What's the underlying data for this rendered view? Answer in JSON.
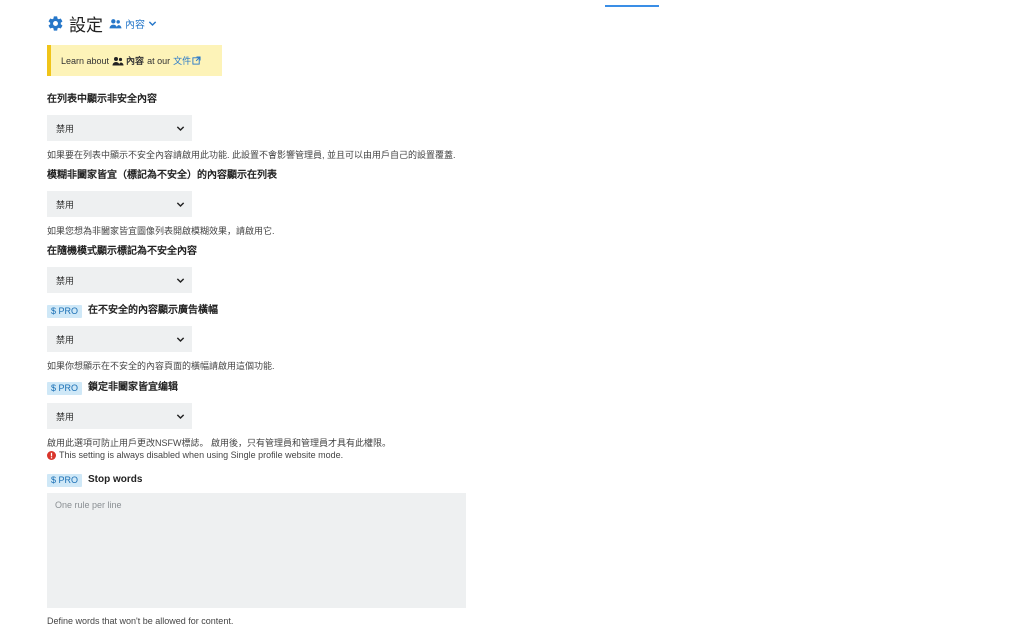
{
  "header": {
    "title": "設定",
    "dropdown_label": "內容"
  },
  "notice": {
    "prefix": "Learn about",
    "subject": "內容",
    "middle": "at our",
    "link": "文件"
  },
  "settings": [
    {
      "label": "在列表中顯示非安全內容",
      "pro": false,
      "value": "禁用",
      "help": "如果要在列表中顯示不安全內容請啟用此功能. 此設置不會影響管理員, 並且可以由用戶自己的設置覆蓋."
    },
    {
      "label": "模糊非闔家皆宜（標記為不安全）的內容顯示在列表",
      "pro": false,
      "value": "禁用",
      "help": "如果您想為非闔家皆宜圖像列表開啟模糊效果，請啟用它."
    },
    {
      "label": "在隨機模式顯示標記為不安全內容",
      "pro": false,
      "value": "禁用",
      "help": ""
    },
    {
      "label": "在不安全的內容顯示廣告橫幅",
      "pro": true,
      "pro_label": "$ PRO",
      "value": "禁用",
      "help": "如果你想顯示在不安全的內容頁面的橫幅請啟用這個功能."
    },
    {
      "label": "鎖定非闔家皆宜编辑",
      "pro": true,
      "pro_label": "$ PRO",
      "value": "禁用",
      "help": "啟用此選項可防止用戶更改NSFW標誌。 啟用後，只有管理員和管理員才具有此權限。",
      "warning": "This setting is always disabled when using Single profile website mode."
    }
  ],
  "stop_words": {
    "pro_label": "$ PRO",
    "label": "Stop words",
    "placeholder": "One rule per line",
    "help": "Define words that won't be allowed for content."
  },
  "colors": {
    "accent": "#2677c9",
    "notice_bg": "#fdf3b8",
    "notice_border": "#f0c419",
    "pro_badge_bg": "#cfe8f7",
    "field_bg": "#eef0f1",
    "warning_red": "#d9352b"
  },
  "icons": {
    "title_icon": "gear-icon",
    "dropdown_icon": "people-icon",
    "link_icon": "external-link-icon",
    "warning_icon": "exclamation-circle-icon"
  }
}
